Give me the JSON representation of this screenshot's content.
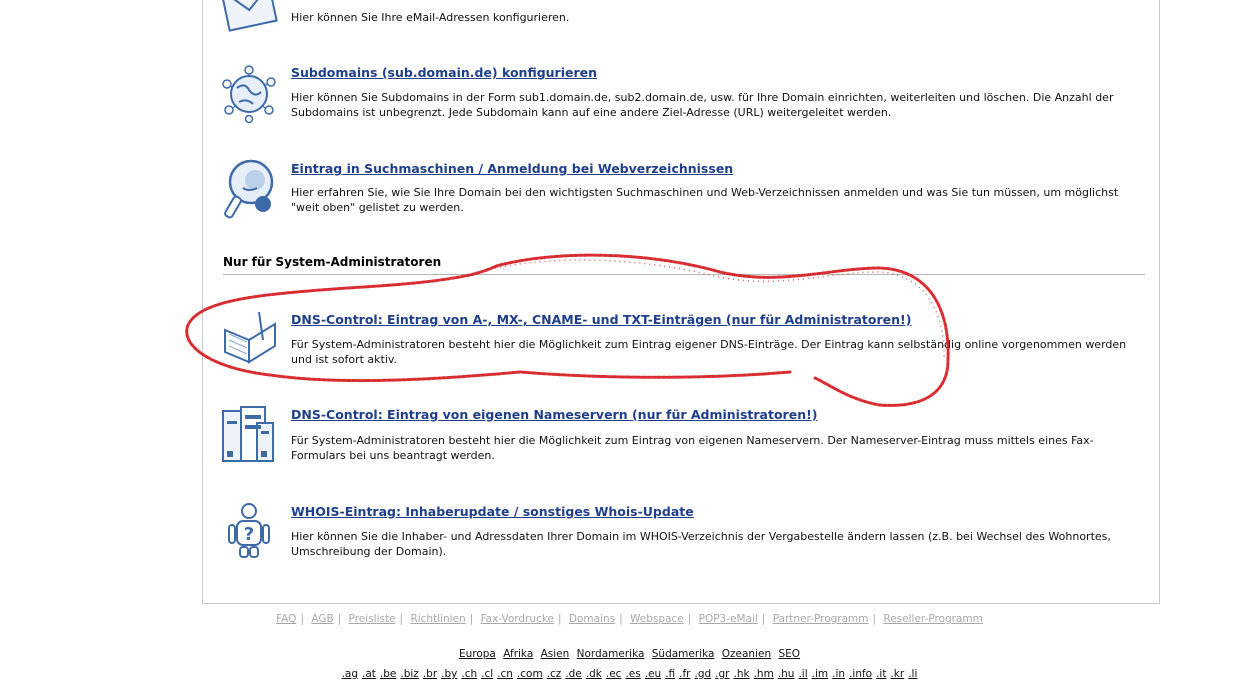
{
  "entries": {
    "email": {
      "desc": "Hier können Sie Ihre eMail-Adressen konfigurieren."
    },
    "subdomains": {
      "title": "Subdomains (sub.domain.de) konfigurieren",
      "desc": "Hier können Sie Subdomains in der Form sub1.domain.de, sub2.domain.de, usw. für Ihre Domain einrichten, weiterleiten und löschen. Die Anzahl der Subdomains ist unbegrenzt. Jede Subdomain kann auf eine andere Ziel-Adresse (URL) weitergeleitet werden."
    },
    "search": {
      "title": "Eintrag in Suchmaschinen / Anmeldung bei Webverzeichnissen",
      "desc": "Hier erfahren Sie, wie Sie Ihre Domain bei den wichtigsten Suchmaschinen und Web-Verzeichnissen anmelden und was Sie tun müssen, um möglichst \"weit oben\" gelistet zu werden."
    },
    "dns": {
      "title": "DNS-Control: Eintrag von A-, MX-, CNAME- und TXT-Einträgen (nur für Administratoren!)",
      "desc": "Für System-Administratoren besteht hier die Möglichkeit zum Eintrag eigener DNS-Einträge. Der Eintrag kann selbständig online vorgenommen werden und ist sofort aktiv."
    },
    "nameserver": {
      "title": "DNS-Control: Eintrag von eigenen Nameservern (nur für Administratoren!)",
      "desc": "Für System-Administratoren besteht hier die Möglichkeit zum Eintrag von eigenen Nameservern. Der Nameserver-Eintrag muss mittels eines Fax-Formulars bei uns beantragt werden."
    },
    "whois": {
      "title": "WHOIS-Eintrag: Inhaberupdate / sonstiges Whois-Update",
      "desc": "Hier können Sie die Inhaber- und Adressdaten Ihrer Domain im WHOIS-Verzeichnis der Vergabestelle ändern lassen (z.B. bei Wechsel des Wohnortes, Umschreibung der Domain)."
    }
  },
  "section_title": "Nur für System-Administratoren",
  "footer": {
    "links": [
      "FAQ",
      "AGB",
      "Preisliste",
      "Richtlinien",
      "Fax-Vordrucke",
      "Domains",
      "Webspace",
      "POP3-eMail",
      "Partner-Programm",
      "Reseller-Programm"
    ],
    "regions": [
      "Europa",
      "Afrika",
      "Asien",
      "Nordamerika",
      "Südamerika",
      "Ozeanien",
      "SEO"
    ],
    "tlds": [
      ".ag",
      ".at",
      ".be",
      ".biz",
      ".br",
      ".by",
      ".ch",
      ".cl",
      ".cn",
      ".com",
      ".cz",
      ".de",
      ".dk",
      ".ec",
      ".es",
      ".eu",
      ".fi",
      ".fr",
      ".gd",
      ".gr",
      ".hk",
      ".hm",
      ".hu",
      ".il",
      ".im",
      ".in",
      ".info",
      ".it",
      ".kr",
      ".li"
    ]
  },
  "colors": {
    "link": "#1f3f8a",
    "icon_blue": "#3f6aa8",
    "scribble": "#d4161c",
    "footer_gray": "#a8a8a8"
  }
}
